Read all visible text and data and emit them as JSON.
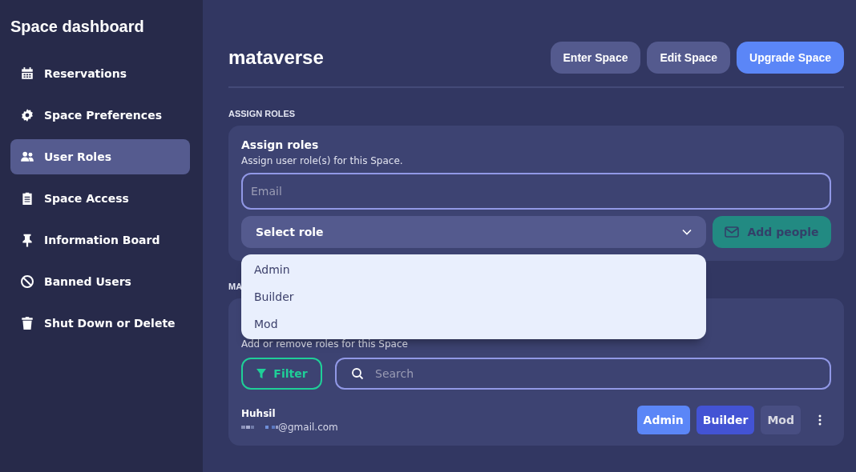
{
  "sidebar": {
    "title": "Space dashboard",
    "items": [
      {
        "label": "Reservations",
        "selected": false
      },
      {
        "label": "Space Preferences",
        "selected": false
      },
      {
        "label": "User Roles",
        "selected": true
      },
      {
        "label": "Space Access",
        "selected": false
      },
      {
        "label": "Information Board",
        "selected": false
      },
      {
        "label": "Banned Users",
        "selected": false
      },
      {
        "label": "Shut Down or Delete",
        "selected": false
      }
    ]
  },
  "header": {
    "title": "mataverse",
    "buttons": [
      {
        "label": "Enter Space",
        "kind": "secondary"
      },
      {
        "label": "Edit Space",
        "kind": "secondary"
      },
      {
        "label": "Upgrade Space",
        "kind": "primary"
      }
    ]
  },
  "assign": {
    "section_label": "ASSIGN ROLES",
    "title": "Assign roles",
    "description": "Assign user role(s) for this Space.",
    "email": {
      "placeholder": "Email"
    },
    "role_select": {
      "value": "Select role",
      "options": [
        "Admin",
        "Builder",
        "Mod"
      ]
    },
    "add_button": {
      "label": "Add people",
      "disabled": true
    }
  },
  "manage": {
    "section_label": "MA",
    "description": "Add or remove roles for this Space",
    "filter_button": "Filter",
    "search": {
      "placeholder": "Search"
    },
    "users": [
      {
        "name": "Huhsil",
        "email": "@gmail.com",
        "roles": [
          {
            "label": "Admin",
            "selected": true,
            "color": "#5b86f7"
          },
          {
            "label": "Builder",
            "selected": true,
            "color": "#4353d4"
          },
          {
            "label": "Mod",
            "selected": false,
            "color": "#4b5186"
          }
        ]
      }
    ]
  }
}
